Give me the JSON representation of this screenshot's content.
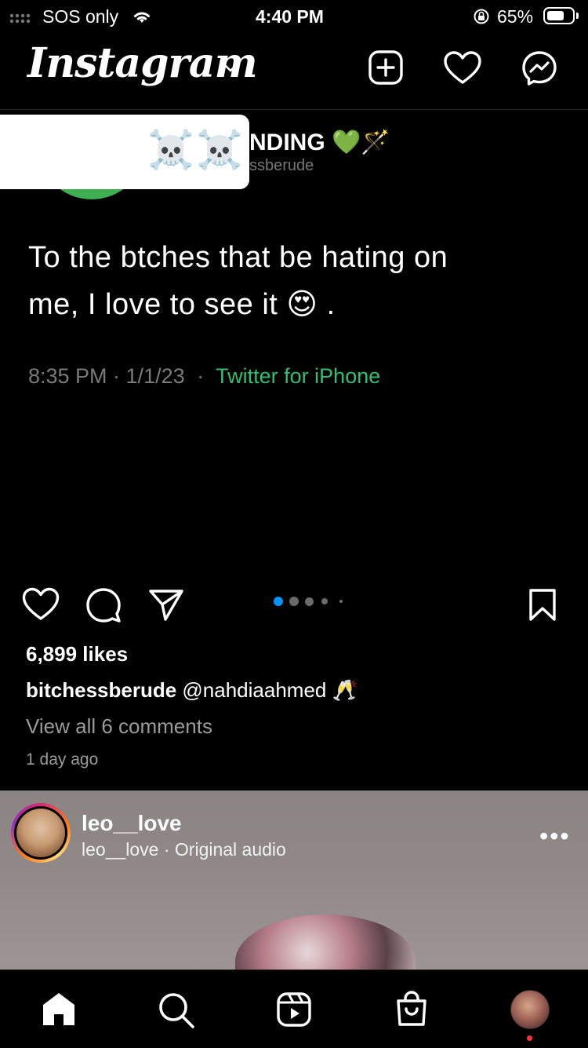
{
  "status_bar": {
    "carrier": "SOS only",
    "time": "4:40 PM",
    "battery_percent": "65%",
    "battery_level": 0.65,
    "icons": [
      "signal-icon",
      "wifi-icon",
      "orientation-lock-icon",
      "battery-icon"
    ]
  },
  "header": {
    "logo": "Instagram",
    "icons": [
      "chevron-down-icon",
      "new-post-icon",
      "heart-icon",
      "messenger-icon"
    ]
  },
  "post1": {
    "overlay_emojis": "😂😂😂☠️☠️",
    "tweet_name": "NDING 💚🪄",
    "tweet_handle": "ssberude",
    "tweet_line1": "To the btches that be hating on",
    "tweet_line2": "me, I love to see it 😍 .",
    "tweet_time": "8:35 PM · 1/1/23",
    "tweet_separator": "·",
    "tweet_source": "Twitter for iPhone",
    "carousel": {
      "total_dots": 5,
      "active_index": 0
    },
    "likes": "6,899 likes",
    "caption_user": "bitchessberude",
    "caption_text": "@nahdiaahmed 🥂",
    "view_comments": "View all 6 comments",
    "time_ago": "1 day ago",
    "icons": [
      "like-heart-icon",
      "comment-icon",
      "share-icon",
      "bookmark-icon"
    ]
  },
  "post2": {
    "username": "leo__love",
    "subtitle": "leo__love · Original audio",
    "more": "•••"
  },
  "bottom_nav": {
    "items": [
      "home-icon",
      "search-icon",
      "reels-icon",
      "shop-icon",
      "profile-avatar"
    ]
  },
  "colors": {
    "background": "#000000",
    "twitter_source_green": "#2fbf71",
    "carousel_active": "#0095f6",
    "notification_dot": "#ff3040"
  }
}
